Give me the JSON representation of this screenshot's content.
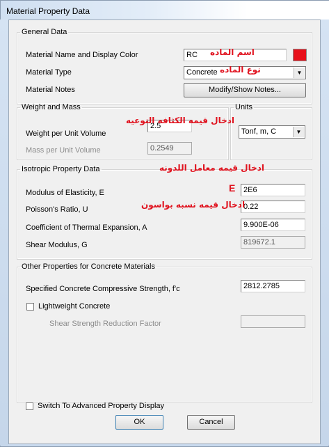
{
  "window": {
    "title": "Material Property Data"
  },
  "general": {
    "legend": "General Data",
    "name_label": "Material Name and Display Color",
    "name_value": "RC",
    "type_label": "Material Type",
    "type_value": "Concrete",
    "notes_label": "Material Notes",
    "notes_button": "Modify/Show Notes...",
    "display_color": "#e8101a"
  },
  "weight": {
    "legend": "Weight and Mass",
    "weight_label": "Weight per Unit Volume",
    "weight_value": "2.5",
    "mass_label": "Mass per Unit Volume",
    "mass_value": "0.2549"
  },
  "units": {
    "legend": "Units",
    "value": "Tonf, m, C"
  },
  "isotropic": {
    "legend": "Isotropic Property Data",
    "e_label": "Modulus of Elasticity,  E",
    "e_value": "2E6",
    "u_label": "Poisson's Ratio,  U",
    "u_value": "0.22",
    "a_label": "Coefficient of Thermal Expansion,  A",
    "a_value": "9.900E-06",
    "g_label": "Shear Modulus,  G",
    "g_value": "819672.1"
  },
  "concrete": {
    "legend": "Other Properties for Concrete Materials",
    "fc_label": "Specified Concrete Compressive Strength, f'c",
    "fc_value": "2812.2785",
    "lightweight_label": "Lightweight Concrete",
    "shear_reduction_label": "Shear Strength Reduction Factor",
    "shear_reduction_value": ""
  },
  "footer": {
    "advanced_label": "Switch To Advanced Property Display",
    "ok": "OK",
    "cancel": "Cancel"
  },
  "annotations": {
    "name": "اسم الماده",
    "type": "نوع الماده",
    "density": "ادخال قيمه الكثافه النوعيه",
    "elastic": "ادخال قيمه معامل اللدونه",
    "e_letter": "E",
    "poisson": "ادخال قيمه نسبه بواسون"
  }
}
